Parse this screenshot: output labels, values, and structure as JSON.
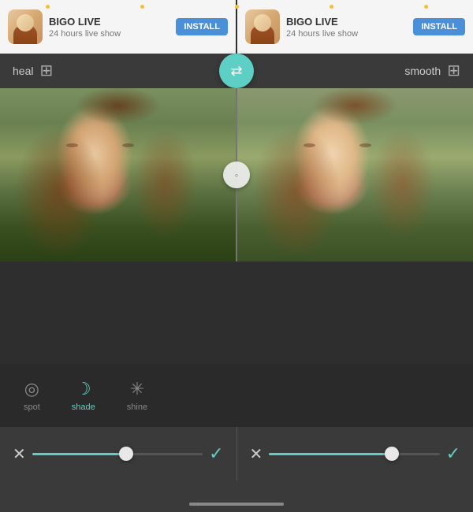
{
  "ads": [
    {
      "title": "BIGO LIVE",
      "subtitle": "24 hours live show",
      "install_label": "INSTALL"
    },
    {
      "title": "BIGO LIVE",
      "subtitle": "24 hours live show",
      "install_label": "INSTALL"
    }
  ],
  "toolbar": {
    "left_label": "heal",
    "right_label": "smooth",
    "fab_icon": "♦"
  },
  "top_dots": [
    "",
    "",
    "",
    "",
    ""
  ],
  "divider": {
    "handle_char": "◦"
  },
  "controls": [
    {
      "label": "spot",
      "icon": "◎",
      "active": false
    },
    {
      "label": "shade",
      "icon": "☾",
      "active": true
    },
    {
      "label": "shine",
      "icon": "✳",
      "active": false
    }
  ],
  "action_bars": [
    {
      "cancel_icon": "✕",
      "confirm_icon": "✓",
      "slider_fill_pct": 55,
      "slider_thumb_pct": 55
    },
    {
      "cancel_icon": "✕",
      "confirm_icon": "✓",
      "slider_fill_pct": 72,
      "slider_thumb_pct": 72
    }
  ],
  "colors": {
    "accent": "#5ecfc4",
    "bg_dark": "#2e2e2e",
    "bg_mid": "#3a3a3a",
    "install_blue": "#4a90d9"
  }
}
